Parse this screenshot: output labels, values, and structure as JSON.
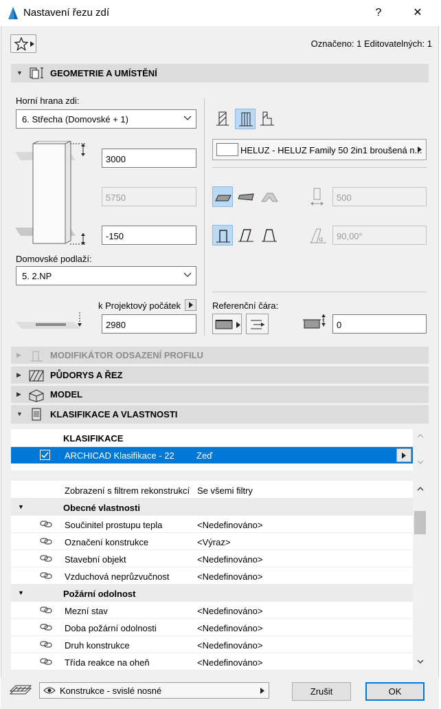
{
  "window": {
    "title": "Nastavení řezu zdí",
    "help": "?",
    "close": "✕"
  },
  "header": {
    "selection_info": "Označeno: 1 Editovatelných: 1"
  },
  "sections": {
    "geometry": "GEOMETRIE A UMÍSTĚNÍ",
    "modifier": "MODIFIKÁTOR ODSAZENÍ PROFILU",
    "plan": "PŮDORYS A ŘEZ",
    "model": "MODEL",
    "classification": "KLASIFIKACE A VLASTNOSTI"
  },
  "geometry": {
    "top_link_label": "Horní hrana zdi:",
    "top_link_value": "6. Střecha (Domovské + 1)",
    "height_top": "3000",
    "height_total": "5750",
    "offset_bottom": "-150",
    "home_story_label": "Domovské podlaží:",
    "home_story_value": "5. 2.NP",
    "project_zero_label": "k Projektový počátek",
    "project_zero_value": "2980",
    "material": "HELUZ - HELUZ Family 50 2in1 broušená n...",
    "thickness": "500",
    "angle": "90,00°",
    "ref_line_label": "Referenční čára:",
    "ref_offset": "0"
  },
  "classification": {
    "header": "KLASIFIKACE",
    "row_system": "ARCHICAD Klasifikace - 22",
    "row_value": "Zeď"
  },
  "properties": {
    "filter_label": "Zobrazení s filtrem rekonstrukcí",
    "filter_value": "Se všemi filtry",
    "groups": [
      {
        "name": "Obecné vlastnosti",
        "rows": [
          {
            "k": "Součinitel prostupu tepla",
            "v": "<Nedefinováno>"
          },
          {
            "k": "Označení konstrukce",
            "v": "<Výraz>"
          },
          {
            "k": "Stavební objekt",
            "v": "<Nedefinováno>"
          },
          {
            "k": "Vzduchová neprůzvučnost",
            "v": "<Nedefinováno>"
          }
        ]
      },
      {
        "name": "Požární odolnost",
        "rows": [
          {
            "k": "Mezní stav",
            "v": "<Nedefinováno>"
          },
          {
            "k": "Doba požární odolnosti",
            "v": "<Nedefinováno>"
          },
          {
            "k": "Druh konstrukce",
            "v": "<Nedefinováno>"
          },
          {
            "k": "Třída reakce na oheň",
            "v": "<Nedefinováno>"
          }
        ]
      }
    ]
  },
  "footer": {
    "layer": "Konstrukce - svislé nosné",
    "cancel": "Zrušit",
    "ok": "OK"
  }
}
